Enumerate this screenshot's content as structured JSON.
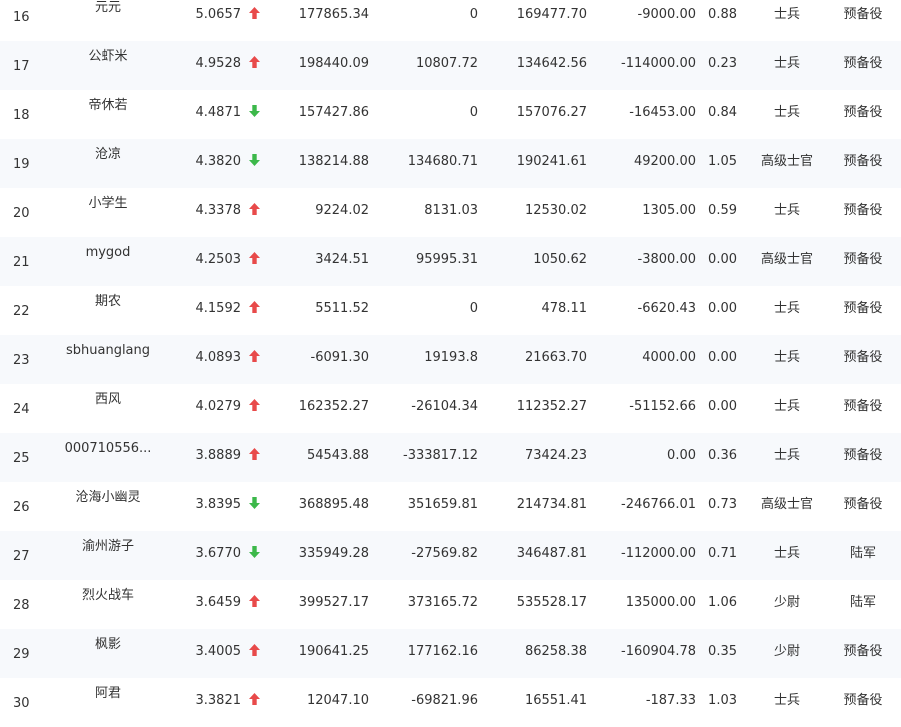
{
  "colors": {
    "up": "#e84a4a",
    "down": "#3cb84a",
    "text": "#333333",
    "row_alt": "#f7f9fc"
  },
  "rows": [
    {
      "rank": "16",
      "name": "元元",
      "score": "5.0657",
      "trend": "up",
      "v1": "177865.34",
      "v2": "0",
      "v3": "169477.70",
      "v4": "-9000.00",
      "ratio": "0.88",
      "military_rank": "士兵",
      "status": "预备役"
    },
    {
      "rank": "17",
      "name": "公虾米",
      "score": "4.9528",
      "trend": "up",
      "v1": "198440.09",
      "v2": "10807.72",
      "v3": "134642.56",
      "v4": "-114000.00",
      "ratio": "0.23",
      "military_rank": "士兵",
      "status": "预备役"
    },
    {
      "rank": "18",
      "name": "帝休若",
      "score": "4.4871",
      "trend": "down",
      "v1": "157427.86",
      "v2": "0",
      "v3": "157076.27",
      "v4": "-16453.00",
      "ratio": "0.84",
      "military_rank": "士兵",
      "status": "预备役"
    },
    {
      "rank": "19",
      "name": "沧凉",
      "score": "4.3820",
      "trend": "down",
      "v1": "138214.88",
      "v2": "134680.71",
      "v3": "190241.61",
      "v4": "49200.00",
      "ratio": "1.05",
      "military_rank": "高级士官",
      "status": "预备役"
    },
    {
      "rank": "20",
      "name": "小学生",
      "score": "4.3378",
      "trend": "up",
      "v1": "9224.02",
      "v2": "8131.03",
      "v3": "12530.02",
      "v4": "1305.00",
      "ratio": "0.59",
      "military_rank": "士兵",
      "status": "预备役"
    },
    {
      "rank": "21",
      "name": "mygod",
      "score": "4.2503",
      "trend": "up",
      "v1": "3424.51",
      "v2": "95995.31",
      "v3": "1050.62",
      "v4": "-3800.00",
      "ratio": "0.00",
      "military_rank": "高级士官",
      "status": "预备役"
    },
    {
      "rank": "22",
      "name": "期农",
      "score": "4.1592",
      "trend": "up",
      "v1": "5511.52",
      "v2": "0",
      "v3": "478.11",
      "v4": "-6620.43",
      "ratio": "0.00",
      "military_rank": "士兵",
      "status": "预备役"
    },
    {
      "rank": "23",
      "name": "sbhuanglang",
      "score": "4.0893",
      "trend": "up",
      "v1": "-6091.30",
      "v2": "19193.8",
      "v3": "21663.70",
      "v4": "4000.00",
      "ratio": "0.00",
      "military_rank": "士兵",
      "status": "预备役"
    },
    {
      "rank": "24",
      "name": "西风",
      "score": "4.0279",
      "trend": "up",
      "v1": "162352.27",
      "v2": "-26104.34",
      "v3": "112352.27",
      "v4": "-51152.66",
      "ratio": "0.00",
      "military_rank": "士兵",
      "status": "预备役"
    },
    {
      "rank": "25",
      "name": "000710556...",
      "score": "3.8889",
      "trend": "up",
      "v1": "54543.88",
      "v2": "-333817.12",
      "v3": "73424.23",
      "v4": "0.00",
      "ratio": "0.36",
      "military_rank": "士兵",
      "status": "预备役"
    },
    {
      "rank": "26",
      "name": "沧海小幽灵",
      "score": "3.8395",
      "trend": "down",
      "v1": "368895.48",
      "v2": "351659.81",
      "v3": "214734.81",
      "v4": "-246766.01",
      "ratio": "0.73",
      "military_rank": "高级士官",
      "status": "预备役"
    },
    {
      "rank": "27",
      "name": "渝州游子",
      "score": "3.6770",
      "trend": "down",
      "v1": "335949.28",
      "v2": "-27569.82",
      "v3": "346487.81",
      "v4": "-112000.00",
      "ratio": "0.71",
      "military_rank": "士兵",
      "status": "陆军"
    },
    {
      "rank": "28",
      "name": "烈火战车",
      "score": "3.6459",
      "trend": "up",
      "v1": "399527.17",
      "v2": "373165.72",
      "v3": "535528.17",
      "v4": "135000.00",
      "ratio": "1.06",
      "military_rank": "少尉",
      "status": "陆军"
    },
    {
      "rank": "29",
      "name": "枫影",
      "score": "3.4005",
      "trend": "up",
      "v1": "190641.25",
      "v2": "177162.16",
      "v3": "86258.38",
      "v4": "-160904.78",
      "ratio": "0.35",
      "military_rank": "少尉",
      "status": "预备役"
    },
    {
      "rank": "30",
      "name": "阿君",
      "score": "3.3821",
      "trend": "up",
      "v1": "12047.10",
      "v2": "-69821.96",
      "v3": "16551.41",
      "v4": "-187.33",
      "ratio": "1.03",
      "military_rank": "士兵",
      "status": "预备役"
    }
  ]
}
